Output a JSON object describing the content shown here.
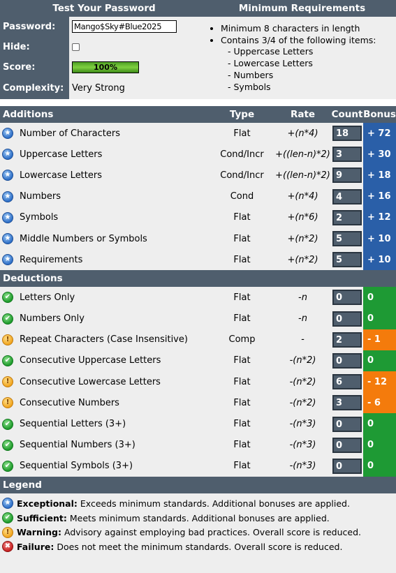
{
  "top": {
    "left_header": "Test Your Password",
    "right_header": "Minimum Requirements",
    "password_label": "Password:",
    "password_value": "Mango$Sky#Blue2025",
    "hide_label": "Hide:",
    "score_label": "Score:",
    "score_text": "100%",
    "score_fraction": 1.0,
    "complexity_label": "Complexity:",
    "complexity_value": "Very Strong",
    "requirements": {
      "item1": "Minimum 8 characters in length",
      "item2": "Contains 3/4 of the following items:",
      "sub": [
        "- Uppercase Letters",
        "- Lowercase Letters",
        "- Numbers",
        "- Symbols"
      ]
    }
  },
  "additions": {
    "headers": {
      "name": "Additions",
      "type": "Type",
      "rate": "Rate",
      "count": "Count",
      "bonus": "Bonus"
    },
    "rows": [
      {
        "name": "Number of Characters",
        "type": "Flat",
        "rate": "+(n*4)",
        "count": "18",
        "bonus": "+ 72",
        "status": "exceptional"
      },
      {
        "name": "Uppercase Letters",
        "type": "Cond/Incr",
        "rate": "+((len-n)*2)",
        "count": "3",
        "bonus": "+ 30",
        "status": "exceptional"
      },
      {
        "name": "Lowercase Letters",
        "type": "Cond/Incr",
        "rate": "+((len-n)*2)",
        "count": "9",
        "bonus": "+ 18",
        "status": "exceptional"
      },
      {
        "name": "Numbers",
        "type": "Cond",
        "rate": "+(n*4)",
        "count": "4",
        "bonus": "+ 16",
        "status": "exceptional"
      },
      {
        "name": "Symbols",
        "type": "Flat",
        "rate": "+(n*6)",
        "count": "2",
        "bonus": "+ 12",
        "status": "exceptional"
      },
      {
        "name": "Middle Numbers or Symbols",
        "type": "Flat",
        "rate": "+(n*2)",
        "count": "5",
        "bonus": "+ 10",
        "status": "exceptional"
      },
      {
        "name": "Requirements",
        "type": "Flat",
        "rate": "+(n*2)",
        "count": "5",
        "bonus": "+ 10",
        "status": "exceptional"
      }
    ]
  },
  "deductions": {
    "header": "Deductions",
    "rows": [
      {
        "name": "Letters Only",
        "type": "Flat",
        "rate": "-n",
        "count": "0",
        "bonus": "0",
        "status": "sufficient"
      },
      {
        "name": "Numbers Only",
        "type": "Flat",
        "rate": "-n",
        "count": "0",
        "bonus": "0",
        "status": "sufficient"
      },
      {
        "name": "Repeat Characters (Case Insensitive)",
        "type": "Comp",
        "rate": "-",
        "count": "2",
        "bonus": "- 1",
        "status": "warning"
      },
      {
        "name": "Consecutive Uppercase Letters",
        "type": "Flat",
        "rate": "-(n*2)",
        "count": "0",
        "bonus": "0",
        "status": "sufficient"
      },
      {
        "name": "Consecutive Lowercase Letters",
        "type": "Flat",
        "rate": "-(n*2)",
        "count": "6",
        "bonus": "- 12",
        "status": "warning"
      },
      {
        "name": "Consecutive Numbers",
        "type": "Flat",
        "rate": "-(n*2)",
        "count": "3",
        "bonus": "- 6",
        "status": "warning"
      },
      {
        "name": "Sequential Letters (3+)",
        "type": "Flat",
        "rate": "-(n*3)",
        "count": "0",
        "bonus": "0",
        "status": "sufficient"
      },
      {
        "name": "Sequential Numbers (3+)",
        "type": "Flat",
        "rate": "-(n*3)",
        "count": "0",
        "bonus": "0",
        "status": "sufficient"
      },
      {
        "name": "Sequential Symbols (3+)",
        "type": "Flat",
        "rate": "-(n*3)",
        "count": "0",
        "bonus": "0",
        "status": "sufficient"
      }
    ]
  },
  "legend": {
    "header": "Legend",
    "items": [
      {
        "term": "Exceptional:",
        "text": "Exceeds minimum standards. Additional bonuses are applied.",
        "status": "exceptional"
      },
      {
        "term": "Sufficient:",
        "text": "Meets minimum standards. Additional bonuses are applied.",
        "status": "sufficient"
      },
      {
        "term": "Warning:",
        "text": "Advisory against employing bad practices. Overall score is reduced.",
        "status": "warning"
      },
      {
        "term": "Failure:",
        "text": "Does not meet the minimum standards. Overall score is reduced.",
        "status": "failure"
      }
    ]
  },
  "icons": {
    "exceptional": "exceptional-icon",
    "sufficient": "sufficient-icon",
    "warning": "warning-icon",
    "failure": "failure-icon"
  },
  "colors": {
    "header": "#4f5e6d",
    "exceptional": "#2a5fa8",
    "sufficient": "#1e9a34",
    "warning": "#f47b0c",
    "failure": "#c91f1f"
  }
}
